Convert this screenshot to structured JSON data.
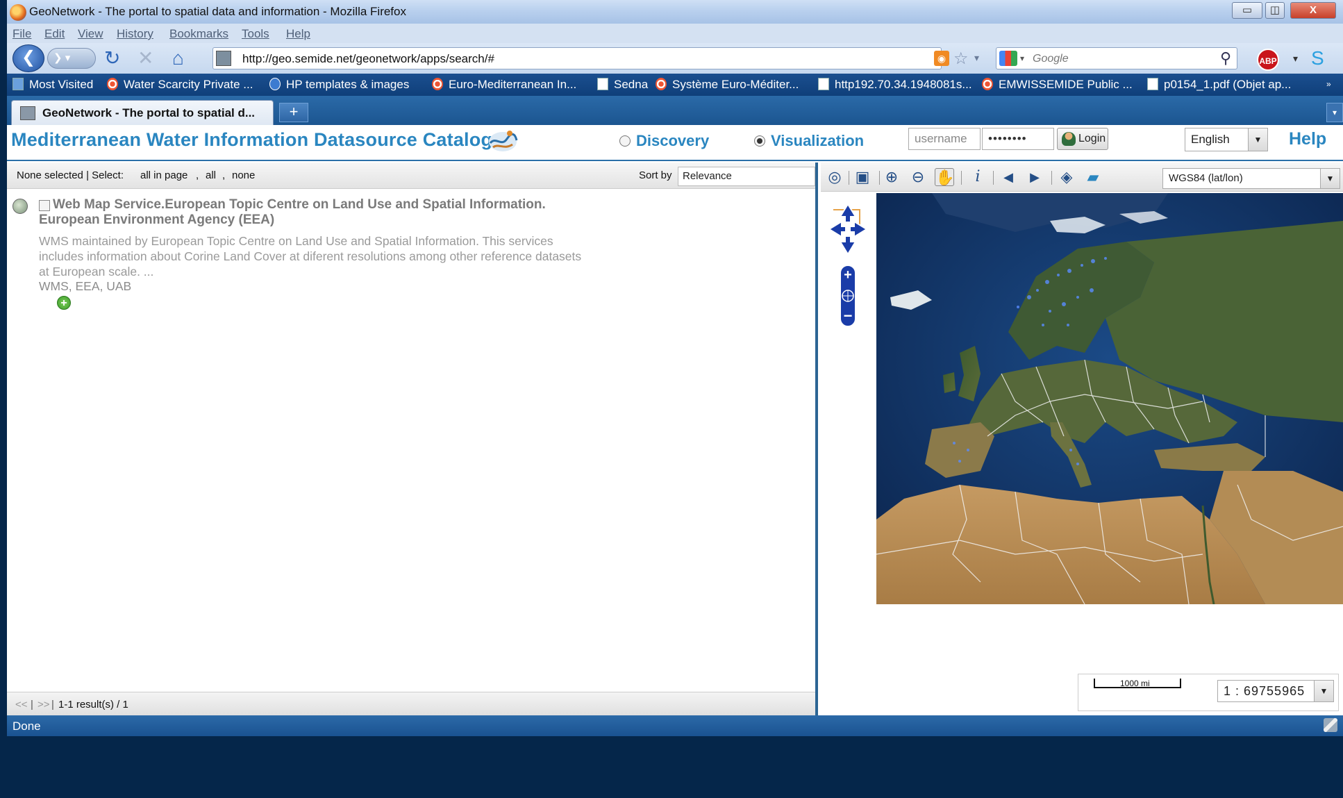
{
  "window": {
    "title": "GeoNetwork - The portal to spatial data and information - Mozilla Firefox",
    "minimize": "▭",
    "restore": "◫",
    "close": "X"
  },
  "menu": [
    "File",
    "Edit",
    "View",
    "History",
    "Bookmarks",
    "Tools",
    "Help"
  ],
  "nav": {
    "url": "http://geo.semide.net/geonetwork/apps/search/#",
    "search_placeholder": "Google",
    "abp_label": "ABP"
  },
  "bookmarks": [
    {
      "label": "Most Visited",
      "icon": "most-visited-icon"
    },
    {
      "label": "Water Scarcity Private ...",
      "icon": "dart-icon"
    },
    {
      "label": "HP  templates & images",
      "icon": "hp-icon"
    },
    {
      "label": "Euro-Mediterranean In...",
      "icon": "dart-icon"
    },
    {
      "label": "Sedna",
      "icon": "page-icon"
    },
    {
      "label": "Système Euro-Méditer...",
      "icon": "dart-icon"
    },
    {
      "label": "http192.70.34.1948081s...",
      "icon": "page-icon"
    },
    {
      "label": "EMWISSEMIDE Public ...",
      "icon": "dart-icon"
    },
    {
      "label": "p0154_1.pdf (Objet ap...",
      "icon": "page-icon"
    }
  ],
  "tabs": {
    "active_label": "GeoNetwork - The portal to spatial d...",
    "new_tab": "+"
  },
  "header": {
    "title": "Mediterranean Water Information Datasource Catalogue",
    "modes": [
      {
        "label": "Discovery",
        "selected": false
      },
      {
        "label": "Visualization",
        "selected": true
      }
    ],
    "username_placeholder": "username",
    "password_mask": "••••••••",
    "login_label": "Login",
    "language": "English",
    "help_label": "Help"
  },
  "results": {
    "selection_text": "None selected | Select:",
    "select_all_in_page": "all in page",
    "select_all": "all",
    "select_none": "none",
    "sort_label": "Sort by",
    "sort_value": "Relevance",
    "items": [
      {
        "title": "Web Map Service.European Topic Centre on Land Use and Spatial Information. European Environment Agency (EEA)",
        "abstract": "WMS maintained by European Topic Centre on Land Use and Spatial Information. This services includes information about Corine Land Cover at diferent resolutions among other reference datasets at European scale. ...",
        "keywords": "WMS, EEA, UAB"
      }
    ],
    "pager_prev": "<<",
    "pager_next": ">>",
    "pager_count": "1-1 result(s) / 1"
  },
  "map": {
    "projection": "WGS84 (lat/lon)",
    "scale_bar_label": "1000 mi",
    "scale_value": "1 : 69755965",
    "toolbar_icons": [
      "zoom-extent-icon",
      "zoom-box-icon",
      "zoom-in-icon",
      "zoom-out-icon",
      "pan-hand-icon",
      "info-icon",
      "previous-extent-icon",
      "next-extent-icon",
      "layers-icon",
      "open-folder-icon"
    ]
  },
  "status": "Done",
  "colors": {
    "accent": "#2a86c0",
    "chrome_blue": "#1b5590",
    "sea": "#0c2a55",
    "land": "#b9905a"
  }
}
